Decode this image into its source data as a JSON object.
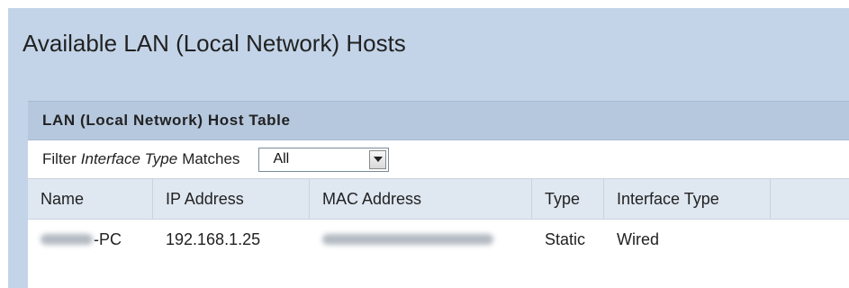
{
  "page": {
    "title": "Available LAN (Local Network) Hosts"
  },
  "table": {
    "title": "LAN (Local Network) Host Table",
    "filter": {
      "prefix": "Filter",
      "field": "Interface Type",
      "suffix": "Matches",
      "selected": "All"
    },
    "columns": [
      "Name",
      "IP Address",
      "MAC Address",
      "Type",
      "Interface Type"
    ],
    "rows": [
      {
        "name_visible": "-PC",
        "ip": "192.168.1.25",
        "type": "Static",
        "interface_type": "Wired"
      }
    ]
  }
}
